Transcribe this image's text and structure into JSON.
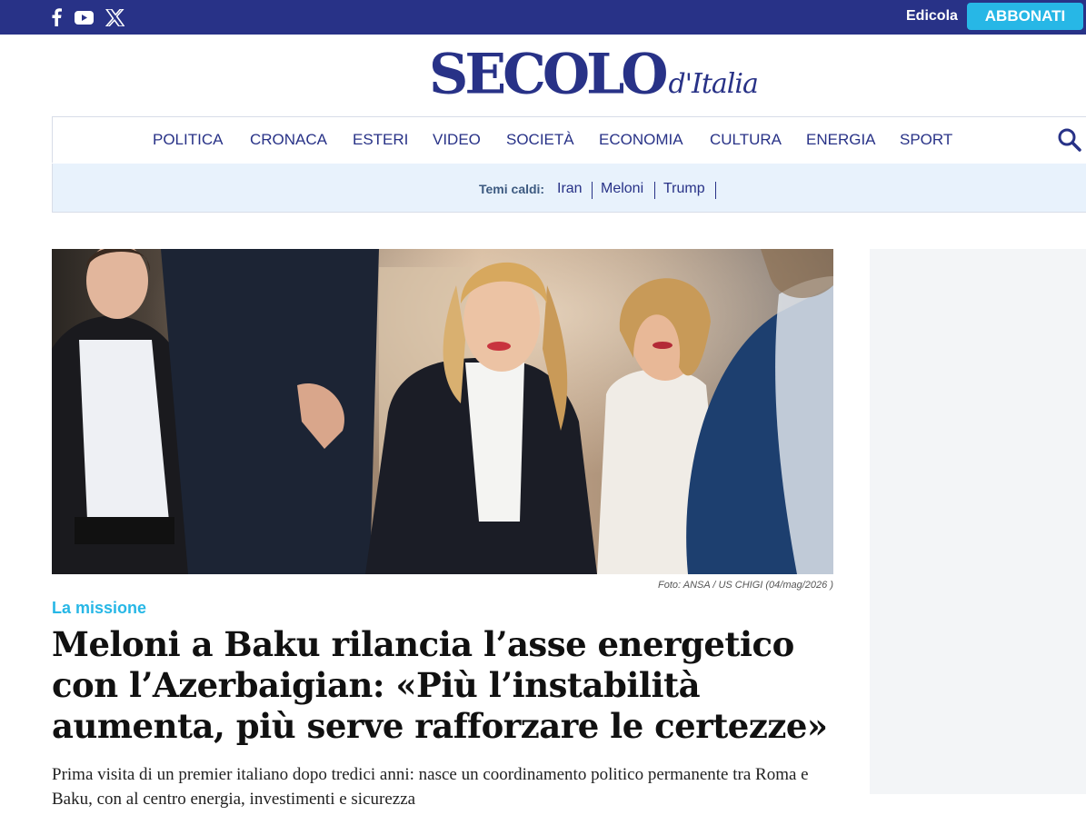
{
  "topbar": {
    "social": [
      {
        "name": "facebook"
      },
      {
        "name": "youtube"
      },
      {
        "name": "x"
      }
    ],
    "edicola_label": "Edicola",
    "subscribe_label": "ABBONATI",
    "bar_color": "#283287",
    "subscribe_color": "#27b7e6"
  },
  "logo": {
    "main": "SECOLO",
    "sub": "d'Italia",
    "color": "#283287"
  },
  "nav": {
    "items": [
      "POLITICA",
      "CRONACA",
      "ESTERI",
      "VIDEO",
      "SOCIETÀ",
      "ECONOMIA",
      "CULTURA",
      "ENERGIA",
      "SPORT"
    ],
    "search_icon": "search-icon"
  },
  "hot_topics": {
    "label": "Temi caldi:",
    "tags": [
      "Iran",
      "Meloni",
      "Trump"
    ]
  },
  "article": {
    "photo_credit": "Foto: ANSA / US CHIGI (04/mag/2026 )",
    "kicker": "La missione",
    "headline": "Meloni a Baku rilancia l’asse energetico con l’Azerbaigian: «Più l’instabilità aumenta, più serve rafforzare le certezze»",
    "summary": "Prima visita di un premier italiano dopo tredici anni: nasce un coordinamento politico permanente tra Roma e Baku, con al centro energia, investimenti e sicurezza",
    "kicker_color": "#27b7e6"
  }
}
